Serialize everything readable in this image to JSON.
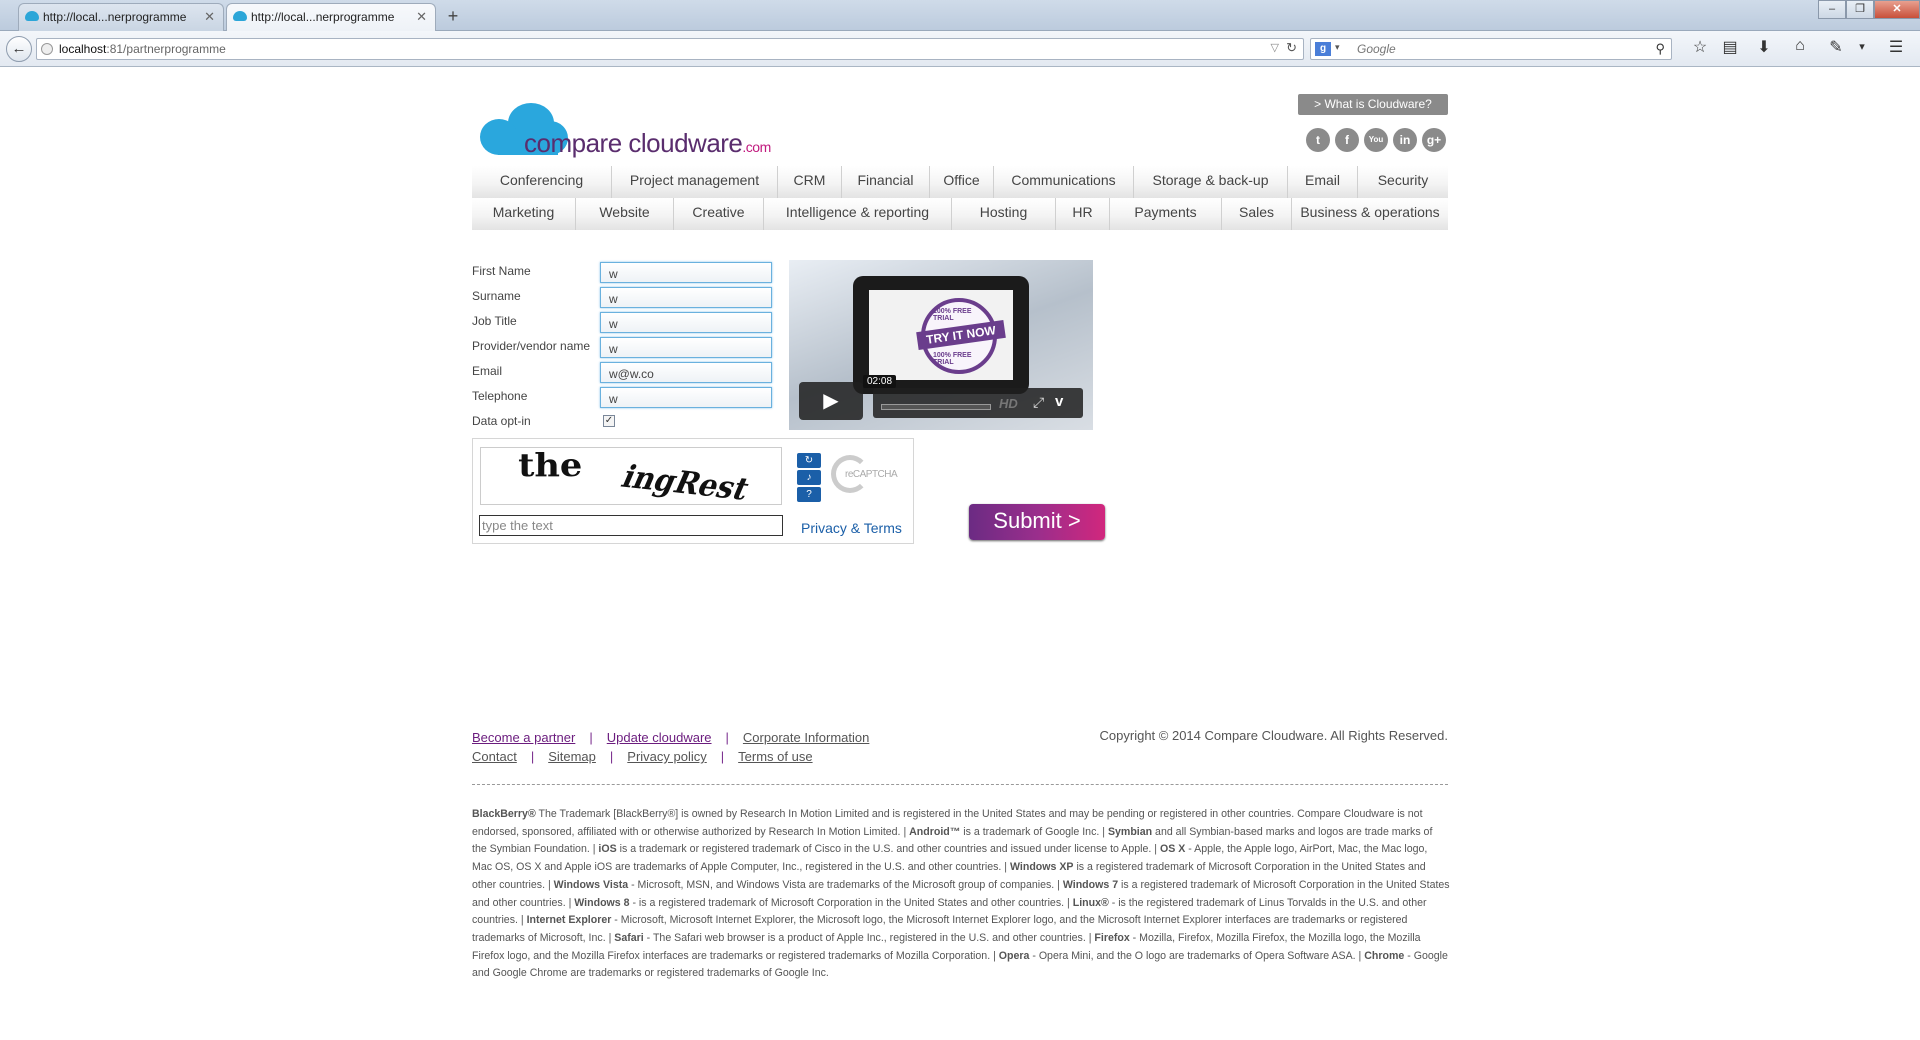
{
  "browser": {
    "tabs": [
      {
        "title": "http://local...nerprogramme",
        "active": false
      },
      {
        "title": "http://local...nerprogramme",
        "active": true
      }
    ],
    "url_host": "localhost",
    "url_path": ":81/partnerprogramme",
    "search_placeholder": "Google"
  },
  "header": {
    "logo_text": "compare cloudware",
    "logo_suffix": ".com",
    "what_is_button": "> What is Cloudware?",
    "social": [
      "twitter",
      "facebook",
      "youtube",
      "linkedin",
      "google-plus"
    ]
  },
  "menu": {
    "row1": [
      "Conferencing",
      "Project management",
      "CRM",
      "Financial",
      "Office",
      "Communications",
      "Storage & back-up",
      "Email",
      "Security"
    ],
    "row2": [
      "Marketing",
      "Website",
      "Creative",
      "Intelligence & reporting",
      "Hosting",
      "HR",
      "Payments",
      "Sales",
      "Business & operations"
    ]
  },
  "form": {
    "fields": [
      {
        "label": "First Name",
        "value": "w"
      },
      {
        "label": "Surname",
        "value": "w"
      },
      {
        "label": "Job Title",
        "value": "w"
      },
      {
        "label": "Provider/vendor name",
        "value": "w"
      },
      {
        "label": "Email",
        "value": "w@w.co"
      },
      {
        "label": "Telephone",
        "value": "w"
      }
    ],
    "optin_label": "Data opt-in",
    "optin_checked": true,
    "captcha": {
      "word1": "the",
      "word2": "ingRest",
      "placeholder": "type the text",
      "privacy_link": "Privacy & Terms",
      "brand": "reCAPTCHA"
    },
    "submit_label": "Submit >"
  },
  "video": {
    "stamp_text": "TRY IT NOW",
    "stamp_ring": "100% FREE TRIAL",
    "time": "02:08",
    "hd_label": "HD"
  },
  "footer": {
    "links_row1": [
      "Become a partner",
      "Update cloudware",
      "Corporate Information"
    ],
    "links_row2": [
      "Contact",
      "Sitemap",
      "Privacy policy",
      "Terms of use"
    ],
    "copyright": "Copyright © 2014 Compare Cloudware. All Rights Reserved.",
    "legal": [
      {
        "b": "BlackBerry®",
        "t": " The Trademark [BlackBerry®] is owned by Research In Motion Limited and is registered in the United States and may be pending or registered in other countries. Compare Cloudware is not endorsed, sponsored, affiliated with or otherwise authorized by Research In Motion Limited. | "
      },
      {
        "b": "Android™",
        "t": " is a trademark of Google Inc. | "
      },
      {
        "b": "Symbian",
        "t": " and all Symbian-based marks and logos are trade marks of the Symbian Foundation. | "
      },
      {
        "b": "iOS",
        "t": " is a trademark or registered trademark of Cisco in the U.S. and other countries and issued under license to Apple. | "
      },
      {
        "b": "OS X",
        "t": " - Apple, the Apple logo, AirPort, Mac, the Mac logo, Mac OS, OS X and Apple iOS are trademarks of Apple Computer, Inc., registered in the U.S. and other countries. | "
      },
      {
        "b": "Windows XP",
        "t": " is a registered trademark of Microsoft Corporation in the United States and other countries. | "
      },
      {
        "b": "Windows Vista",
        "t": " - Microsoft, MSN, and Windows Vista are trademarks of the Microsoft group of companies. | "
      },
      {
        "b": "Windows 7",
        "t": " is a registered trademark of Microsoft Corporation in the United States and other countries. | "
      },
      {
        "b": "Windows 8",
        "t": " - is a registered trademark of Microsoft Corporation in the United States and other countries. | "
      },
      {
        "b": "Linux®",
        "t": " - is the registered trademark of Linus Torvalds in the U.S. and other countries. | "
      },
      {
        "b": "Internet Explorer",
        "t": " - Microsoft, Microsoft Internet Explorer, the Microsoft logo, the Microsoft Internet Explorer logo, and the Microsoft Internet Explorer interfaces are trademarks or registered trademarks of Microsoft, Inc. | "
      },
      {
        "b": "Safari",
        "t": " - The Safari web browser is a product of Apple Inc., registered in the U.S. and other countries. | "
      },
      {
        "b": "Firefox",
        "t": " - Mozilla, Firefox, Mozilla Firefox, the Mozilla logo, the Mozilla Firefox logo, and the Mozilla Firefox interfaces are trademarks or registered trademarks of Mozilla Corporation. | "
      },
      {
        "b": "Opera",
        "t": " - Opera Mini, and the O logo are trademarks of Opera Software ASA. | "
      },
      {
        "b": "Chrome",
        "t": " - Google and Google Chrome are trademarks or registered trademarks of Google Inc."
      }
    ]
  }
}
